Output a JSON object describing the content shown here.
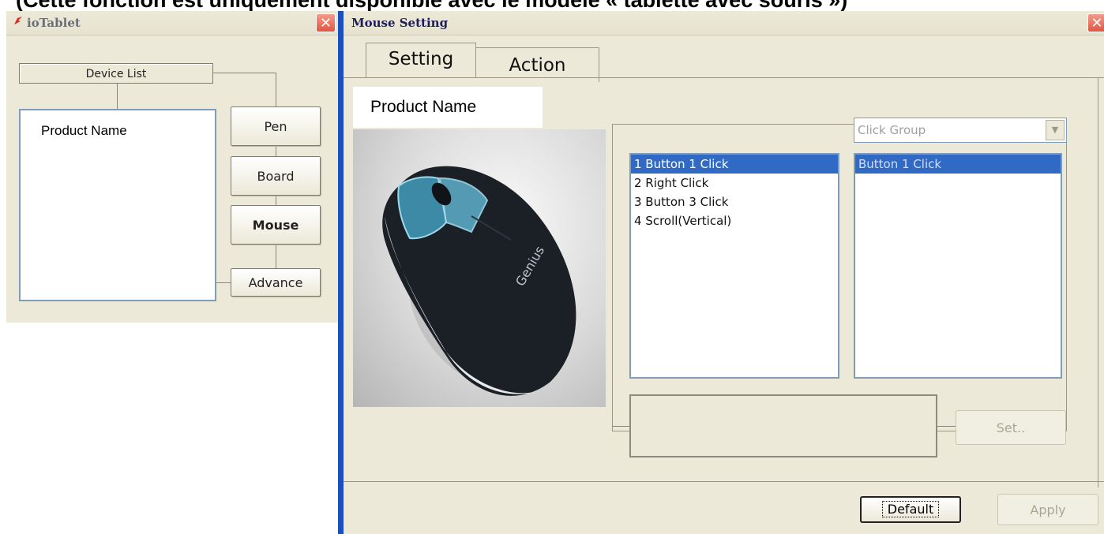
{
  "caption": "(Cette fonction est uniquement disponible avec le modèle « tablette avec souris »)",
  "left_window": {
    "title": "ioTablet",
    "close_label": "✕",
    "device_list_label": "Device List",
    "device_list_items": [
      "Product Name"
    ],
    "nav": {
      "pen": "Pen",
      "board": "Board",
      "mouse": "Mouse",
      "advance": "Advance"
    }
  },
  "right_window": {
    "title": "Mouse Setting",
    "close_label": "✕",
    "tabs": [
      {
        "label": "Setting",
        "active": true
      },
      {
        "label": "Action",
        "active": false
      }
    ],
    "product_name": "Product Name",
    "button_list": [
      {
        "label": "1  Button 1 Click",
        "selected": true
      },
      {
        "label": "2  Right Click",
        "selected": false
      },
      {
        "label": "3  Button 3 Click",
        "selected": false
      },
      {
        "label": "4  Scroll(Vertical)",
        "selected": false
      }
    ],
    "group_combo": {
      "value": "Click Group"
    },
    "action_list": [
      {
        "label": "Button 1 Click",
        "selected": true
      }
    ],
    "set_button": "Set..",
    "default_button": "Default",
    "apply_button": "Apply"
  },
  "colors": {
    "window_bg": "#ece9d8",
    "selection": "#316ac5",
    "divider_blue": "#1c4fbe",
    "close_red": "#e0563f"
  }
}
